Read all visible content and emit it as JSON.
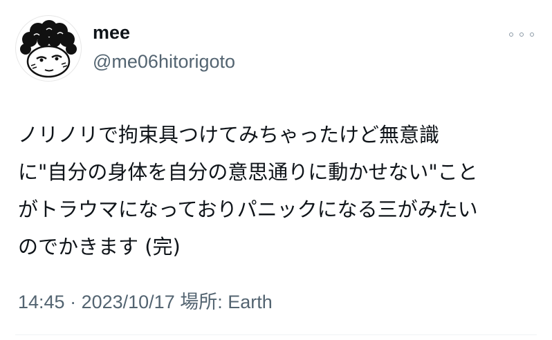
{
  "author": {
    "display_name": "mee",
    "handle": "@me06hitorigoto",
    "avatar_icon": "cartoon-face-avatar"
  },
  "more_icon": "more-dots-icon",
  "tweet": {
    "lines": [
      "ノリノリで拘束具つけてみちゃったけど無意識",
      "に\"自分の身体を自分の意思通りに動かせない\"こと",
      "がトラウマになっておりパニックになる三がみたい",
      "のでかきます (完)"
    ]
  },
  "meta": {
    "time": "14:45",
    "separator": " · ",
    "date": "2023/10/17",
    "location_label": " 場所: ",
    "location": "Earth"
  },
  "colors": {
    "text": "#0f1419",
    "secondary": "#536471",
    "divider": "#eff3f4"
  }
}
